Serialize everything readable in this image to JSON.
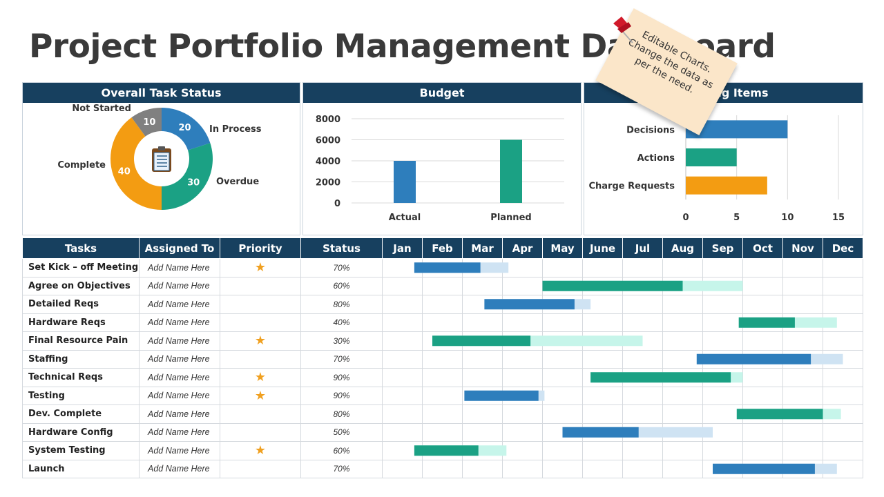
{
  "title": "Project Portfolio Management Dashboard",
  "panels": {
    "task_status": "Overall Task Status",
    "budget": "Budget",
    "pending": "Pending Items"
  },
  "note": "Editable Charts. Change the data as per the need.",
  "colors": {
    "blue": "#2e7ebc",
    "teal": "#1ba184",
    "orange": "#f39c12",
    "gray": "#808080",
    "light_blue": "#cfe3f3",
    "light_teal": "#c6f5ea",
    "header": "#17405f"
  },
  "chart_data": [
    {
      "type": "pie",
      "title": "Overall Task Status",
      "center_icon": "clipboard-icon",
      "slices": [
        {
          "label": "In Process",
          "value": 20,
          "color": "#2e7ebc"
        },
        {
          "label": "Overdue",
          "value": 30,
          "color": "#1ba184"
        },
        {
          "label": "Complete",
          "value": 40,
          "color": "#f39c12"
        },
        {
          "label": "Not Started",
          "value": 10,
          "color": "#808080"
        }
      ]
    },
    {
      "type": "bar",
      "title": "Budget",
      "categories": [
        "Actual",
        "Planned"
      ],
      "values": [
        4000,
        6000
      ],
      "colors": [
        "#2e7ebc",
        "#1ba184"
      ],
      "yticks": [
        "0",
        "2000",
        "4000",
        "6000",
        "8000"
      ],
      "ylim": [
        0,
        8000
      ],
      "grid": true
    },
    {
      "type": "bar",
      "orientation": "horizontal",
      "title": "Pending Items",
      "categories": [
        "Decisions",
        "Actions",
        "Charge Requests"
      ],
      "values": [
        10,
        5,
        8
      ],
      "colors": [
        "#2e7ebc",
        "#1ba184",
        "#f39c12"
      ],
      "xticks": [
        "0",
        "5",
        "10",
        "15"
      ],
      "xlim": [
        0,
        15
      ],
      "grid": true
    }
  ],
  "table": {
    "headers": [
      "Tasks",
      "Assigned To",
      "Priority",
      "Status"
    ],
    "months": [
      "Jan",
      "Feb",
      "Mar",
      "Apr",
      "May",
      "June",
      "Jul",
      "Aug",
      "Sep",
      "Oct",
      "Nov",
      "Dec"
    ],
    "rows": [
      {
        "task": "Set Kick – off Meeting",
        "assigned": "Add Name Here",
        "priority": true,
        "status": "70%",
        "start": 0.8,
        "done": 2.45,
        "end": 3.15,
        "color": "blue"
      },
      {
        "task": "Agree on Objectives",
        "assigned": "Add Name Here",
        "priority": false,
        "status": "60%",
        "start": 4.0,
        "done": 7.5,
        "end": 9.0,
        "color": "teal"
      },
      {
        "task": "Detailed Reqs",
        "assigned": "Add Name Here",
        "priority": false,
        "status": "80%",
        "start": 2.55,
        "done": 4.8,
        "end": 5.2,
        "color": "blue"
      },
      {
        "task": "Hardware Reqs",
        "assigned": "Add Name Here",
        "priority": false,
        "status": "40%",
        "start": 8.9,
        "done": 10.3,
        "end": 11.35,
        "color": "teal"
      },
      {
        "task": "Final Resource Pain",
        "assigned": "Add Name Here",
        "priority": true,
        "status": "30%",
        "start": 1.25,
        "done": 3.7,
        "end": 6.5,
        "color": "teal"
      },
      {
        "task": "Staffing",
        "assigned": "Add Name Here",
        "priority": false,
        "status": "70%",
        "start": 7.85,
        "done": 10.7,
        "end": 11.5,
        "color": "blue"
      },
      {
        "task": "Technical Reqs",
        "assigned": "Add Name Here",
        "priority": true,
        "status": "90%",
        "start": 5.2,
        "done": 8.7,
        "end": 9.0,
        "color": "teal"
      },
      {
        "task": "Testing",
        "assigned": "Add Name Here",
        "priority": true,
        "status": "90%",
        "start": 2.05,
        "done": 3.9,
        "end": 4.05,
        "color": "blue"
      },
      {
        "task": "Dev. Complete",
        "assigned": "Add Name Here",
        "priority": false,
        "status": "80%",
        "start": 8.85,
        "done": 11.0,
        "end": 11.45,
        "color": "teal"
      },
      {
        "task": "Hardware Config",
        "assigned": "Add Name Here",
        "priority": false,
        "status": "50%",
        "start": 4.5,
        "done": 6.4,
        "end": 8.25,
        "color": "blue"
      },
      {
        "task": "System Testing",
        "assigned": "Add Name Here",
        "priority": true,
        "status": "60%",
        "start": 0.8,
        "done": 2.4,
        "end": 3.1,
        "color": "teal"
      },
      {
        "task": "Launch",
        "assigned": "Add Name Here",
        "priority": false,
        "status": "70%",
        "start": 8.25,
        "done": 10.8,
        "end": 11.35,
        "color": "blue"
      }
    ]
  }
}
